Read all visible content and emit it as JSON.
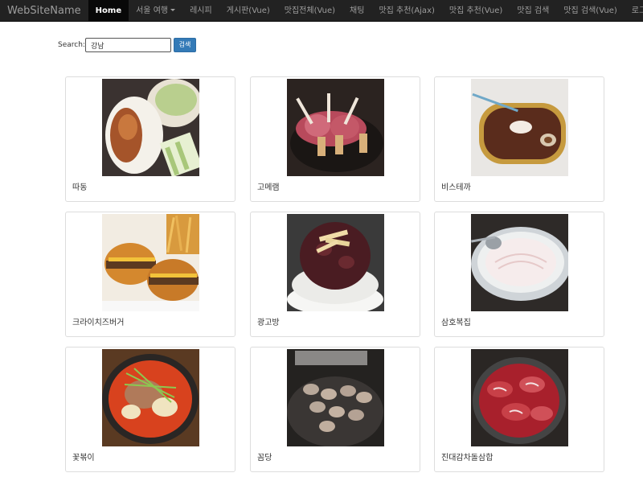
{
  "navbar": {
    "brand": "WebSiteName",
    "items": [
      {
        "label": "Home",
        "active": true
      },
      {
        "label": "서울 여행",
        "dropdown": true
      },
      {
        "label": "레시피"
      },
      {
        "label": "게시판(Vue)"
      },
      {
        "label": "맛집전체(Vue)"
      },
      {
        "label": "채팅"
      },
      {
        "label": "맛집 추천(Ajax)"
      },
      {
        "label": "맛집 추천(Vue)"
      },
      {
        "label": "맛집 검색"
      },
      {
        "label": "맛집 검색(Vue)"
      },
      {
        "label": "로그인"
      }
    ]
  },
  "search": {
    "label": "Search:",
    "value": "강남",
    "button_label": "검색"
  },
  "restaurants": [
    {
      "name": "따동",
      "photo": "peking-duck"
    },
    {
      "name": "고메램",
      "photo": "lamb-rack"
    },
    {
      "name": "비스테까",
      "photo": "chocolate-dessert"
    },
    {
      "name": "크라이치즈버거",
      "photo": "cheeseburgers"
    },
    {
      "name": "광고방",
      "photo": "red-bean-bingsu"
    },
    {
      "name": "삼호복집",
      "photo": "pufferfish-sashimi"
    },
    {
      "name": "꽃볶이",
      "photo": "tteokbokki"
    },
    {
      "name": "꼼당",
      "photo": "grilled-pork"
    },
    {
      "name": "진대감차돌삼합",
      "photo": "beef-brisket"
    }
  ],
  "colors": {
    "navbar_bg": "#222222",
    "nav_active_bg": "#080808",
    "button_primary": "#337ab7"
  }
}
